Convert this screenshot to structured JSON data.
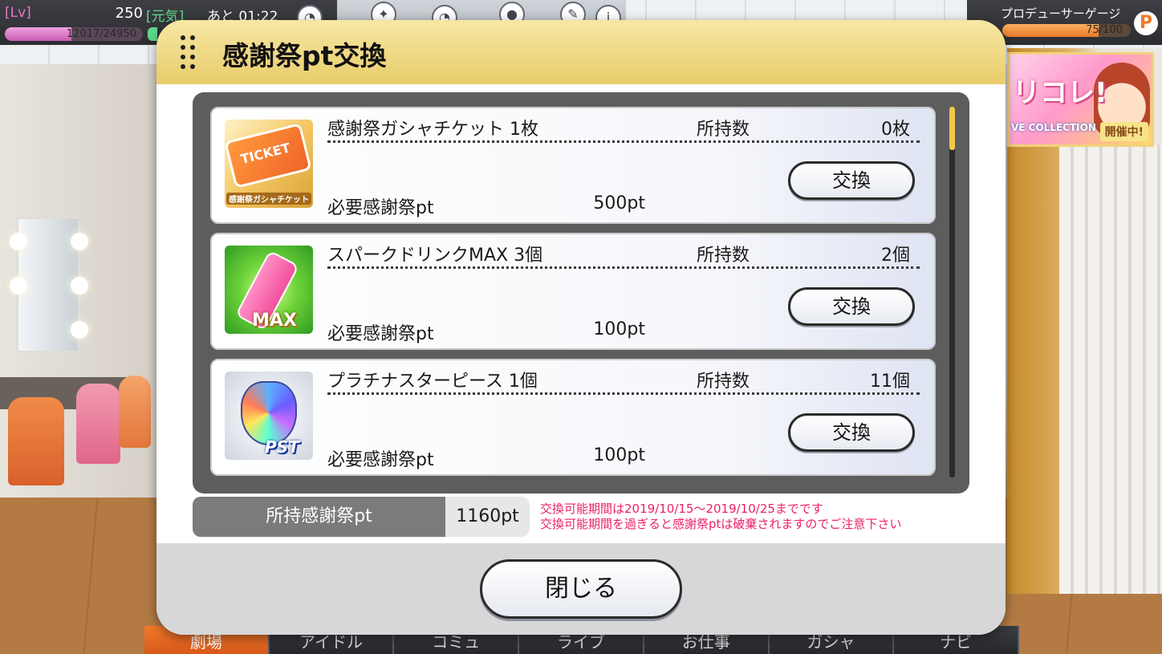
{
  "hud": {
    "lv_label": "[Lv]",
    "lv_value": "250",
    "genki_label": "[元気]",
    "time": "あと 01:22",
    "exp_text": "12017/24950",
    "exp_ratio": 0.48,
    "produce_label": "プロデューサーゲージ",
    "produce_text": "75/100",
    "produce_ratio": 0.75,
    "produce_icon": "P"
  },
  "banner": {
    "title": "リコレ!",
    "subtitle": "VE COLLECTION",
    "badge": "開催中!"
  },
  "modal": {
    "title": "感謝祭pt交換",
    "items": [
      {
        "name": "感謝祭ガシャチケット 1枚",
        "owned_label": "所持数",
        "owned_value": "0枚",
        "req_label": "必要感謝祭pt",
        "req_value": "500pt",
        "button_label": "交換",
        "thumb_text": "TICKET",
        "thumb_caption": "感謝祭ガシャチケット",
        "icon": "ticket-icon"
      },
      {
        "name": "スパークドリンクMAX 3個",
        "owned_label": "所持数",
        "owned_value": "2個",
        "req_label": "必要感謝祭pt",
        "req_value": "100pt",
        "button_label": "交換",
        "thumb_text": "MAX",
        "icon": "drink-bottle-icon"
      },
      {
        "name": "プラチナスターピース 1個",
        "owned_label": "所持数",
        "owned_value": "11個",
        "req_label": "必要感謝祭pt",
        "req_value": "100pt",
        "button_label": "交換",
        "thumb_text": "PST",
        "icon": "gem-icon"
      }
    ],
    "points_label": "所持感謝祭pt",
    "points_value": "1160pt",
    "notice_line1": "交換可能期間は2019/10/15～2019/10/25までです",
    "notice_line2": "交換可能期間を過ぎると感謝祭ptは破棄されますのでご注意下さい",
    "close_label": "閉じる",
    "notice_color": "#ec1f6a"
  },
  "bottom_nav": [
    "劇場",
    "アイドル",
    "コミュ",
    "ライブ",
    "お仕事",
    "ガシャ",
    "ナビ"
  ]
}
